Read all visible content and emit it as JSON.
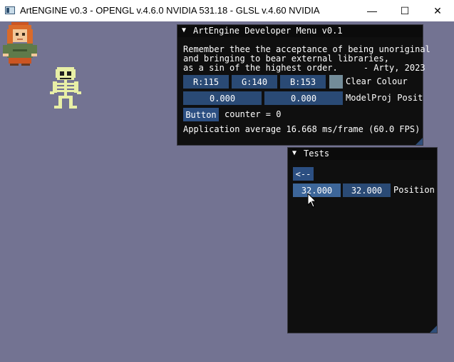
{
  "window": {
    "title": "ArtENGINE v0.3 - OPENGL v.4.6.0 NVIDIA 531.18 - GLSL v.4.60 NVIDIA",
    "minimize_glyph": "—",
    "maximize_glyph": "☐",
    "close_glyph": "✕"
  },
  "dev_menu": {
    "title": "ArtEngine Developer Menu v0.1",
    "collapse_glyph": "▼",
    "quote_line1": "Remember thee the acceptance of being unoriginal",
    "quote_line2": "and bringing to bear external libraries,",
    "quote_line3": "as a sin of the highest order.     - Arty, 2023",
    "r_value": "R:115",
    "g_value": "G:140",
    "b_value": "B:153",
    "clear_colour_label": "Clear Colour",
    "clear_colour": "#738c99",
    "modelproj_x": "0.000",
    "modelproj_y": "0.000",
    "modelproj_label": "ModelProj Posit",
    "button_label": "Button",
    "counter_text": "counter = 0",
    "fps_text": "Application average 16.668 ms/frame (60.0 FPS)"
  },
  "tests_menu": {
    "title": "Tests",
    "collapse_glyph": "▼",
    "back_label": "<--",
    "pos_x": "32.000",
    "pos_y": "32.000",
    "position_label": "Position"
  },
  "colors": {
    "background": "#737392",
    "panel": "#0f0f0f",
    "field": "#2a4a75",
    "button": "#2c4f82"
  }
}
